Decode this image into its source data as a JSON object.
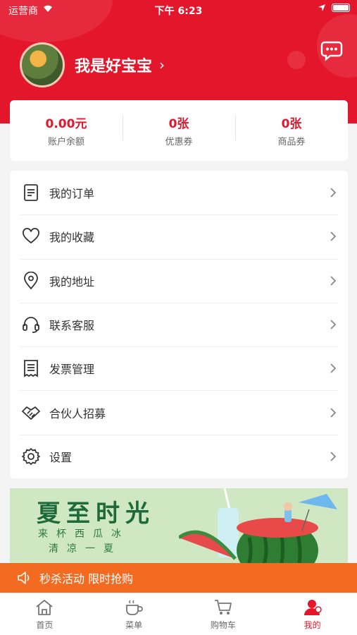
{
  "status_bar": {
    "carrier": "运营商",
    "time": "下午 6:23"
  },
  "user": {
    "name": "我是好宝宝"
  },
  "stats": [
    {
      "value": "0.00元",
      "label": "账户余额"
    },
    {
      "value": "0张",
      "label": "优惠券"
    },
    {
      "value": "0张",
      "label": "商品券"
    }
  ],
  "menu": [
    {
      "label": "我的订单",
      "icon": "order-icon"
    },
    {
      "label": "我的收藏",
      "icon": "heart-icon"
    },
    {
      "label": "我的地址",
      "icon": "location-pin-icon"
    },
    {
      "label": "联系客服",
      "icon": "headset-icon"
    },
    {
      "label": "发票管理",
      "icon": "invoice-icon"
    },
    {
      "label": "合伙人招募",
      "icon": "handshake-icon"
    },
    {
      "label": "设置",
      "icon": "gear-icon"
    }
  ],
  "banner": {
    "title": "夏至时光",
    "line1": "来杯西瓜冰",
    "line2": "清凉一夏"
  },
  "promo": {
    "text": "秒杀活动 限时抢购"
  },
  "tabs": [
    {
      "label": "首页",
      "icon": "home-icon"
    },
    {
      "label": "菜单",
      "icon": "coffee-cup-icon"
    },
    {
      "label": "购物车",
      "icon": "cart-icon"
    },
    {
      "label": "我的",
      "icon": "user-icon",
      "active": true
    }
  ],
  "colors": {
    "brand_red": "#e4162b",
    "promo_orange": "#f26b21",
    "banner_green": "#cfe7c3"
  }
}
